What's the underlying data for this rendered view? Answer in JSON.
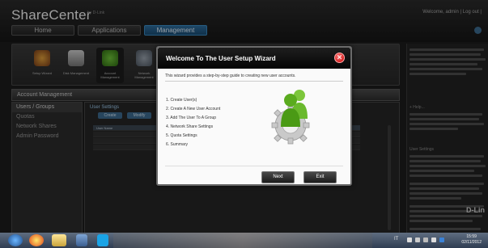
{
  "header": {
    "brand": "ShareCenter",
    "brand_sub": "by D-Link",
    "welcome": "Welcome, admin | Log out |",
    "nav": [
      "Home",
      "Applications",
      "Management"
    ]
  },
  "applications": [
    "Setup Wizard",
    "Disk Management",
    "Account Management",
    "Network Management"
  ],
  "account_management": {
    "title": "Account Management",
    "sidebar": [
      "Users / Groups",
      "Quotas",
      "Network Shares",
      "Admin Password"
    ],
    "content_title": "User Settings",
    "buttons": [
      "Create",
      "Modify"
    ],
    "grid_header": "User Name"
  },
  "wizard": {
    "title": "Welcome To The User Setup Wizard",
    "description": "This wizard provides a step-by-step guide to creating new user accounts.",
    "steps": [
      "1. Create User(s)",
      "2. Create A New User Account",
      "3. Add The User To A Group",
      "4. Network Share Settings",
      "5. Quota Settings",
      "6. Summary"
    ],
    "next_label": "Next",
    "exit_label": "Exit",
    "close_glyph": "✕"
  },
  "help_panel": {
    "heading_help": "+ Help...",
    "heading_user": "User Settings",
    "brand": "D-Lin"
  },
  "taskbar": {
    "language": "IT",
    "time": "15:59",
    "date": "02/11/2012"
  },
  "colors": {
    "accent": "#1d5b8a",
    "wizard_header": "#0a0a0a",
    "close_red": "#d01010",
    "user_green": "#5aab1e"
  }
}
